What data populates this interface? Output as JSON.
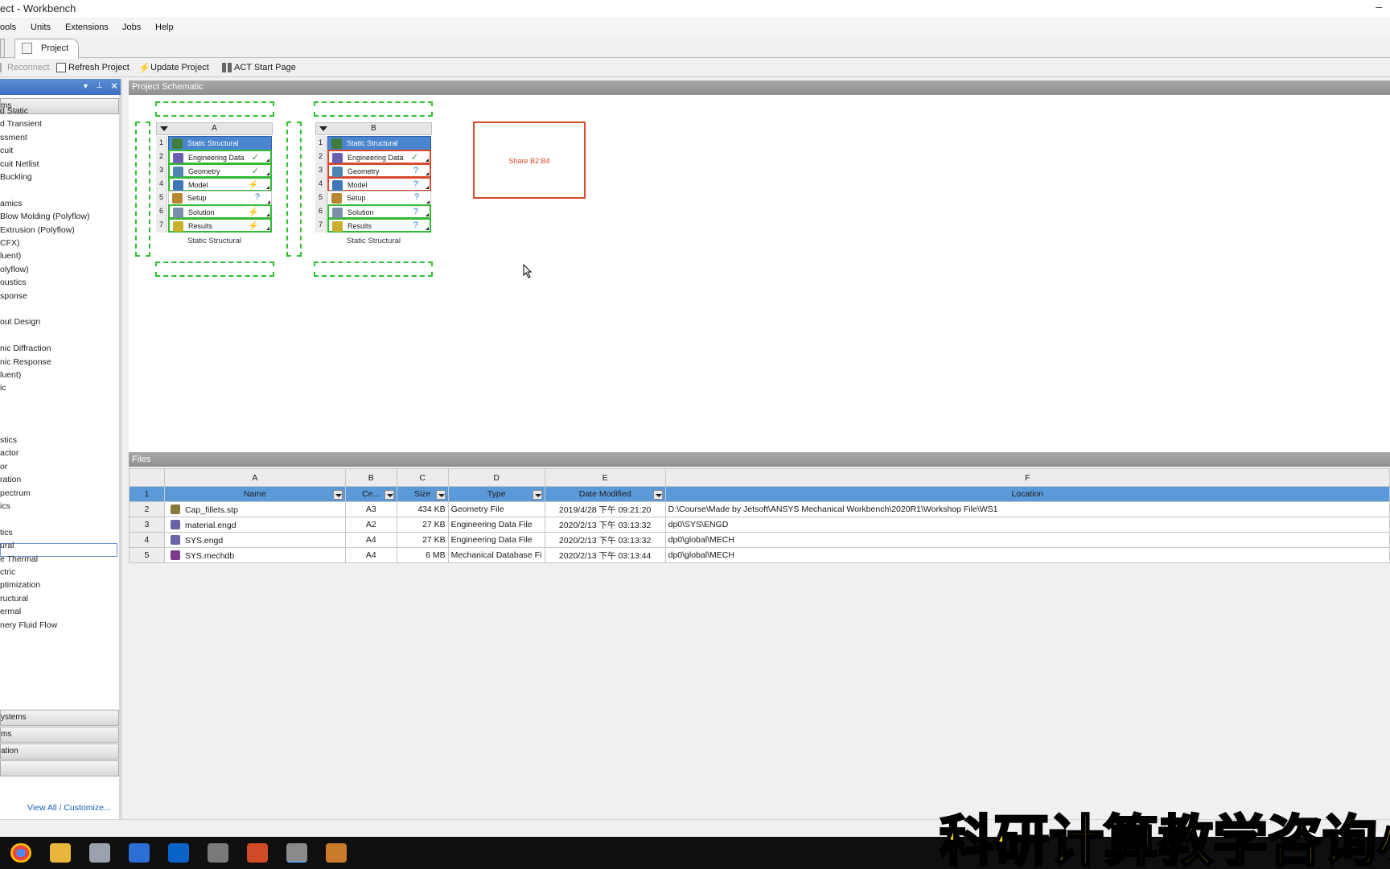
{
  "window": {
    "title": "ect - Workbench",
    "minimize": "–"
  },
  "menu": [
    "ools",
    "Units",
    "Extensions",
    "Jobs",
    "Help"
  ],
  "tabs": {
    "project": "Project"
  },
  "toolbar": {
    "reconnect": "Reconnect",
    "refresh": "Refresh Project",
    "update": "Update Project",
    "act": "ACT Start Page"
  },
  "toolbox": {
    "group_top": "ms",
    "items_a": [
      "d Static",
      "d Transient",
      "ssment",
      "cuit",
      "cuit Netlist",
      "Buckling",
      "",
      "amics",
      "Blow Molding (Polyflow)",
      "Extrusion (Polyflow)",
      "CFX)",
      "luent)",
      "olyflow)",
      "oustics",
      "sponse",
      "",
      "out Design",
      "",
      "nic Diffraction",
      "nic Response",
      "luent)",
      "ic"
    ],
    "items_b": [
      "stics",
      "actor",
      "or",
      "ration",
      "pectrum",
      "ics",
      "",
      "tics",
      "ural",
      "e Thermal",
      "ctric",
      "ptimization",
      "ructural",
      "ermal",
      "nery Fluid Flow"
    ],
    "groups_bottom": [
      "ystems",
      "ms",
      "ation",
      ""
    ],
    "view_all": "View All / Customize..."
  },
  "schematic": {
    "header": "Project Schematic",
    "systems": [
      {
        "letter": "A",
        "caption": "Static Structural",
        "rows": [
          {
            "n": "1",
            "label": "Static Structural",
            "state": ""
          },
          {
            "n": "2",
            "label": "Engineering Data",
            "state": "✓"
          },
          {
            "n": "3",
            "label": "Geometry",
            "state": "✓"
          },
          {
            "n": "4",
            "label": "Model",
            "state": "⚡"
          },
          {
            "n": "5",
            "label": "Setup",
            "state": "?"
          },
          {
            "n": "6",
            "label": "Solution",
            "state": "⚡"
          },
          {
            "n": "7",
            "label": "Results",
            "state": "⚡"
          }
        ]
      },
      {
        "letter": "B",
        "caption": "Static Structural",
        "rows": [
          {
            "n": "1",
            "label": "Static Structural",
            "state": ""
          },
          {
            "n": "2",
            "label": "Engineering Data",
            "state": "✓"
          },
          {
            "n": "3",
            "label": "Geometry",
            "state": "?"
          },
          {
            "n": "4",
            "label": "Model",
            "state": "?"
          },
          {
            "n": "5",
            "label": "Setup",
            "state": "?"
          },
          {
            "n": "6",
            "label": "Solution",
            "state": "?"
          },
          {
            "n": "7",
            "label": "Results",
            "state": "?"
          }
        ]
      }
    ],
    "share_label": "Share B2:B4"
  },
  "files": {
    "header": "Files",
    "letters": [
      "A",
      "B",
      "C",
      "D",
      "E",
      "F"
    ],
    "row_numbers": [
      "1",
      "2",
      "3",
      "4",
      "5"
    ],
    "columns": [
      "Name",
      "Ce...",
      "Size",
      "Type",
      "Date Modified",
      "Location"
    ],
    "rows": [
      {
        "name": "Cap_fillets.stp",
        "cell": "A3",
        "size": "434 KB",
        "type": "Geometry File",
        "date": "2019/4/28 下午 09:21:20",
        "location": "D:\\Course\\Made by Jetsoft\\ANSYS Mechanical Workbench\\2020R1\\Workshop File\\WS1"
      },
      {
        "name": "material.engd",
        "cell": "A2",
        "size": "27 KB",
        "type": "Engineering Data File",
        "date": "2020/2/13 下午 03:13:32",
        "location": "dp0\\SYS\\ENGD"
      },
      {
        "name": "SYS.engd",
        "cell": "A4",
        "size": "27 KB",
        "type": "Engineering Data File",
        "date": "2020/2/13 下午 03:13:32",
        "location": "dp0\\global\\MECH"
      },
      {
        "name": "SYS.mechdb",
        "cell": "A4",
        "size": "6 MB",
        "type": "Mechanical Database Fi",
        "date": "2020/2/13 下午 03:13:44",
        "location": "dp0\\global\\MECH"
      }
    ]
  },
  "overlay_text": "科研计算教学咨询小",
  "colors": {
    "title_row": "#4a86cf",
    "ok": "#33b933",
    "error": "#d9492b",
    "header_blue": "#5b9ad8"
  }
}
